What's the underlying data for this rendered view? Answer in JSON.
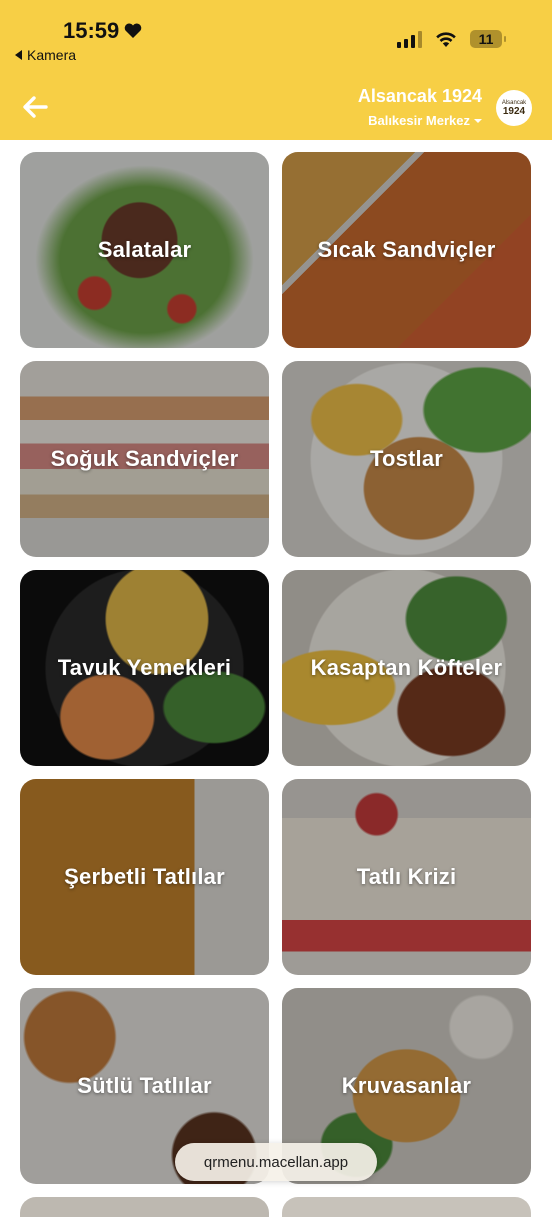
{
  "status_bar": {
    "time": "15:59",
    "back_app_label": "Kamera",
    "battery_level": "11",
    "signal_icon": "signal-bars-icon",
    "wifi_icon": "wifi-icon",
    "heart_icon": "heart-icon"
  },
  "header": {
    "back_icon": "arrow-left-icon",
    "branch_name": "Alsancak 1924",
    "sub_location": "Balıkesir Merkez",
    "dropdown_icon": "caret-down-icon",
    "logo": {
      "top_text": "Alsancak",
      "year": "1924"
    }
  },
  "categories": [
    {
      "label": "Salatalar"
    },
    {
      "label": "Sıcak Sandviçler"
    },
    {
      "label": "Soğuk Sandviçler"
    },
    {
      "label": "Tostlar"
    },
    {
      "label": "Tavuk Yemekleri"
    },
    {
      "label": "Kasaptan Köfteler"
    },
    {
      "label": "Şerbetli Tatlılar"
    },
    {
      "label": "Tatlı Krizi"
    },
    {
      "label": "Sütlü Tatlılar"
    },
    {
      "label": "Kruvasanlar"
    }
  ],
  "footer": {
    "url": "qrmenu.macellan.app"
  },
  "colors": {
    "header_bg": "#f7cf45",
    "header_text": "#ffffff"
  }
}
